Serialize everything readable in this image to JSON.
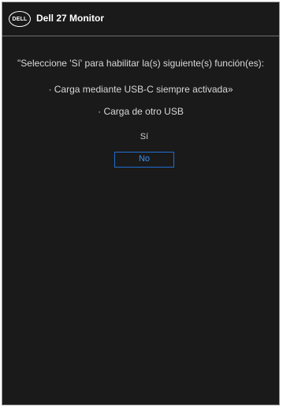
{
  "header": {
    "logo_text": "DELL",
    "title": "Dell 27 Monitor"
  },
  "dialog": {
    "prompt": "\"Seleccione 'Sí' para habilitar la(s) siguiente(s) función(es):",
    "features": [
      "· Carga mediante USB-C siempre activada»",
      "· Carga de otro USB"
    ],
    "options": {
      "yes_label": "Sí",
      "no_label": "No",
      "selected": "No"
    }
  },
  "colors": {
    "background": "#1a1a1a",
    "text": "#d8d8d8",
    "accent": "#1f6fd1"
  }
}
